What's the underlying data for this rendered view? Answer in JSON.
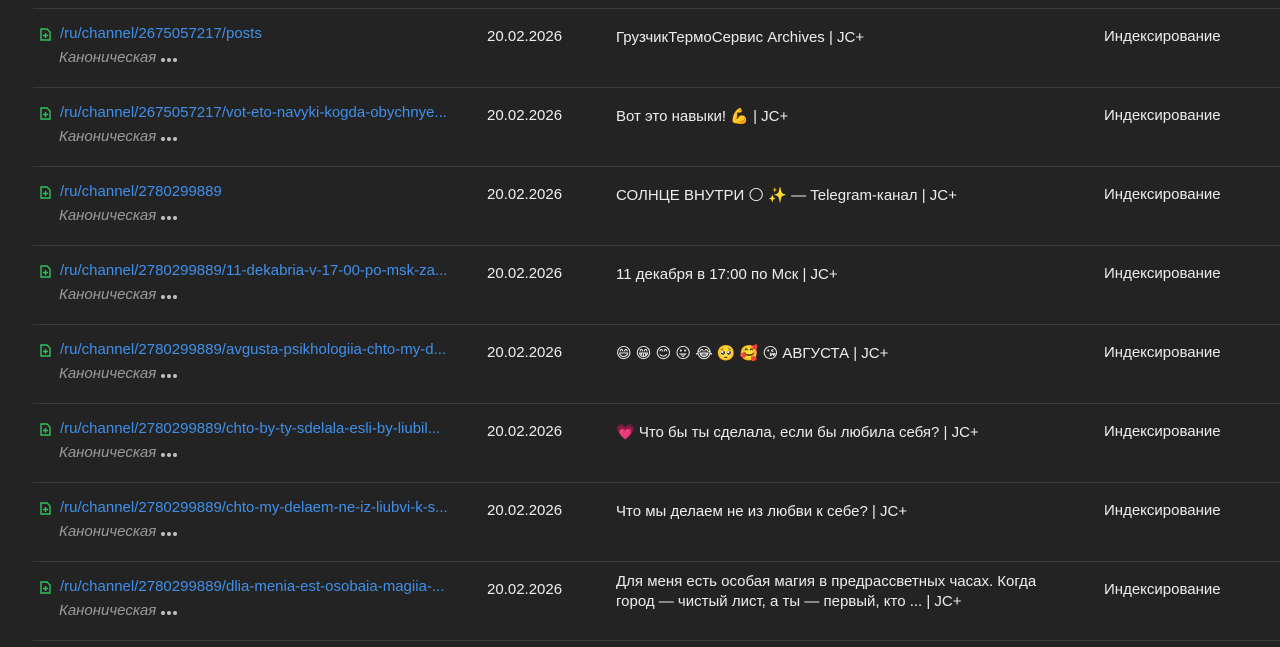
{
  "rows": [
    {
      "url": "/ru/channel/2675057217/posts",
      "canonical": "Каноническая",
      "date": "20.02.2026",
      "title": "ГрузчикТермоСервис Archives | JC+",
      "status": "Индексирование"
    },
    {
      "url": "/ru/channel/2675057217/vot-eto-navyki-kogda-obychnye...",
      "canonical": "Каноническая",
      "date": "20.02.2026",
      "title": "Вот это навыки! 💪 | JC+",
      "status": "Индексирование"
    },
    {
      "url": "/ru/channel/2780299889",
      "canonical": "Каноническая",
      "date": "20.02.2026",
      "title": "СОЛНЦЕ ВНУТРИ 🌕 ✨ — Telegram-канал | JC+",
      "status": "Индексирование"
    },
    {
      "url": "/ru/channel/2780299889/11-dekabria-v-17-00-po-msk-za...",
      "canonical": "Каноническая",
      "date": "20.02.2026",
      "title": "11 декабря в 17:00 по Мск | JC+",
      "status": "Индексирование"
    },
    {
      "url": "/ru/channel/2780299889/avgusta-psikhologiia-chto-my-d...",
      "canonical": "Каноническая",
      "date": "20.02.2026",
      "title": "😄 😁 😊 😛 😂 🥺 🥰 😘 АВГУСТА | JC+",
      "status": "Индексирование"
    },
    {
      "url": "/ru/channel/2780299889/chto-by-ty-sdelala-esli-by-liubil...",
      "canonical": "Каноническая",
      "date": "20.02.2026",
      "title": "💗 Что бы ты сделала, если бы любила себя? | JC+",
      "status": "Индексирование"
    },
    {
      "url": "/ru/channel/2780299889/chto-my-delaem-ne-iz-liubvi-k-s...",
      "canonical": "Каноническая",
      "date": "20.02.2026",
      "title": "Что мы делаем не из любви к себе? | JC+",
      "status": "Индексирование"
    },
    {
      "url": "/ru/channel/2780299889/dlia-menia-est-osobaia-magiia-...",
      "canonical": "Каноническая",
      "date": "20.02.2026",
      "title": "Для меня есть особая магия в предрассветных часах. Когда город — чистый лист, а ты — первый, кто ... | JC+",
      "status": "Индексирование"
    }
  ]
}
